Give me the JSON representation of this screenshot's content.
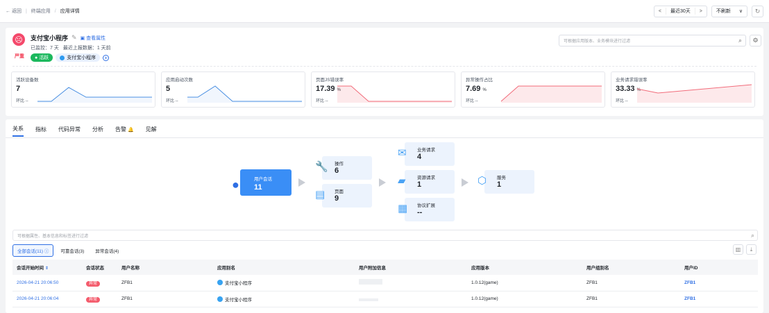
{
  "topbar": {
    "back": "← 返回",
    "crumb1": "终端应用",
    "crumb_sep": "/",
    "crumb2": "应用详情",
    "prev": "<",
    "range": "最近30天",
    "next": ">",
    "refresh_select": "不刷新",
    "caret": "∨",
    "refresh_icon": "↻"
  },
  "app": {
    "name": "支付宝小程序",
    "view_props": "查看属性",
    "severity": "严重",
    "meta_monitored": "已监控：",
    "meta_days": "7 天",
    "meta_last_report": "最近上报数据：",
    "meta_ago": "1 天前",
    "tag_active": "活跃",
    "tag_platform": "支付宝小程序",
    "search_placeholder": "可根据应用版本、业务模块进行过滤"
  },
  "metrics": [
    {
      "label": "活跃设备数",
      "value": "7",
      "unit": "",
      "cmp": "环比  --"
    },
    {
      "label": "应用启动次数",
      "value": "5",
      "unit": "",
      "cmp": "环比  --"
    },
    {
      "label": "页面JS错误率",
      "value": "17.39",
      "unit": "%",
      "cmp": "环比  --"
    },
    {
      "label": "异常操作占比",
      "value": "7.69",
      "unit": "%",
      "cmp": "环比  --"
    },
    {
      "label": "业务请求错误率",
      "value": "33.33",
      "unit": "%",
      "cmp": "环比  --"
    }
  ],
  "tabs": [
    {
      "label": "关系"
    },
    {
      "label": "指标"
    },
    {
      "label": "代码异常"
    },
    {
      "label": "分析"
    },
    {
      "label": "告警"
    },
    {
      "label": "见解"
    }
  ],
  "flow": {
    "session": {
      "label": "用户会话",
      "value": "11"
    },
    "operation": {
      "label": "操作",
      "value": "6"
    },
    "page": {
      "label": "页面",
      "value": "9"
    },
    "biz_request": {
      "label": "业务请求",
      "value": "4"
    },
    "res_request": {
      "label": "资源请求",
      "value": "1"
    },
    "protocol": {
      "label": "协议扩展",
      "value": "--"
    },
    "service": {
      "label": "服务",
      "value": "1"
    }
  },
  "session_search_placeholder": "可根据属性、基本信息和标签进行过滤",
  "subtabs": [
    {
      "label": "全部会话(11)"
    },
    {
      "label": "可靠会话(3)"
    },
    {
      "label": "异常会话(4)"
    }
  ],
  "table": {
    "headers": [
      "会话开始时间",
      "会话状态",
      "用户名称",
      "应用别名",
      "用户附加信息",
      "应用版本",
      "用户组别名",
      "用户ID"
    ],
    "rows": [
      {
        "time": "2026-04-21 20:06:50",
        "status": "异常",
        "user": "ZFB1",
        "alias": "支付宝小程序",
        "version": "1.0.12(game)",
        "group": "ZFB1",
        "uid": "ZFB1"
      },
      {
        "time": "2026-04-21 20:06:04",
        "status": "异常",
        "user": "ZFB1",
        "alias": "支付宝小程序",
        "version": "1.0.12(game)",
        "group": "ZFB1",
        "uid": "ZFB1"
      }
    ]
  }
}
